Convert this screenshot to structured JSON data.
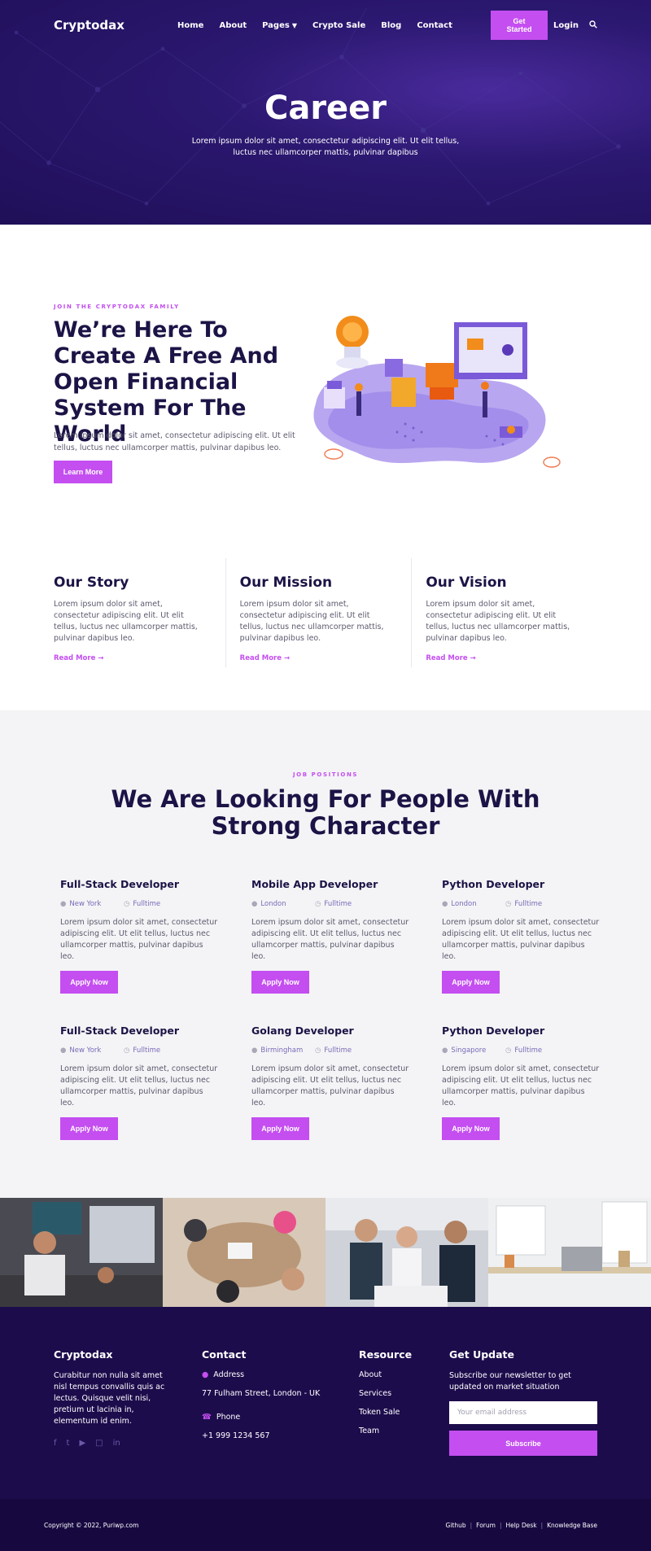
{
  "nav": {
    "logo": "Cryptodax",
    "items": [
      "Home",
      "About",
      "Pages",
      "Crypto Sale",
      "Blog",
      "Contact"
    ],
    "get_started": "Get Started",
    "login": "Login"
  },
  "hero": {
    "title": "Career",
    "subtitle": "Lorem ipsum dolor sit amet, consectetur adipiscing elit. Ut elit tellus, luctus nec ullamcorper mattis, pulvinar dapibus"
  },
  "intro": {
    "eyebrow": "JOIN THE CRYPTODAX FAMILY",
    "heading": "We’re Here To Create A Free And Open Financial System For The World",
    "text": "Lorem ipsum dolor sit amet, consectetur adipiscing elit. Ut elit tellus, luctus nec ullamcorper mattis, pulvinar dapibus leo.",
    "button": "Learn More"
  },
  "story": [
    {
      "title": "Our Story",
      "text": "Lorem ipsum dolor sit amet, consectetur adipiscing elit. Ut elit tellus, luctus nec ullamcorper mattis, pulvinar dapibus leo.",
      "link": "Read More"
    },
    {
      "title": "Our Mission",
      "text": "Lorem ipsum dolor sit amet, consectetur adipiscing elit. Ut elit tellus, luctus nec ullamcorper mattis, pulvinar dapibus leo.",
      "link": "Read More"
    },
    {
      "title": "Our Vision",
      "text": "Lorem ipsum dolor sit amet, consectetur adipiscing elit. Ut elit tellus, luctus nec ullamcorper mattis, pulvinar dapibus leo.",
      "link": "Read More"
    }
  ],
  "jobs": {
    "eyebrow": "JOB POSITIONS",
    "heading": "We Are Looking For People With Strong Character",
    "items": [
      {
        "title": "Full-Stack Developer",
        "location": "New York",
        "type": "Fulltime",
        "text": "Lorem ipsum dolor sit amet, consectetur adipiscing elit. Ut elit tellus, luctus nec ullamcorper mattis, pulvinar dapibus leo.",
        "button": "Apply Now"
      },
      {
        "title": "Mobile App Developer",
        "location": "London",
        "type": "Fulltime",
        "text": "Lorem ipsum dolor sit amet, consectetur adipiscing elit. Ut elit tellus, luctus nec ullamcorper mattis, pulvinar dapibus leo.",
        "button": "Apply Now"
      },
      {
        "title": "Python Developer",
        "location": "London",
        "type": "Fulltime",
        "text": "Lorem ipsum dolor sit amet, consectetur adipiscing elit. Ut elit tellus, luctus nec ullamcorper mattis, pulvinar dapibus leo.",
        "button": "Apply Now"
      },
      {
        "title": "Full-Stack Developer",
        "location": "New York",
        "type": "Fulltime",
        "text": "Lorem ipsum dolor sit amet, consectetur adipiscing elit. Ut elit tellus, luctus nec ullamcorper mattis, pulvinar dapibus leo.",
        "button": "Apply Now"
      },
      {
        "title": "Golang Developer",
        "location": "Birmingham",
        "type": "Fulltime",
        "text": "Lorem ipsum dolor sit amet, consectetur adipiscing elit. Ut elit tellus, luctus nec ullamcorper mattis, pulvinar dapibus leo.",
        "button": "Apply Now"
      },
      {
        "title": "Python Developer",
        "location": "Singapore",
        "type": "Fulltime",
        "text": "Lorem ipsum dolor sit amet, consectetur adipiscing elit. Ut elit tellus, luctus nec ullamcorper mattis, pulvinar dapibus leo.",
        "button": "Apply Now"
      }
    ]
  },
  "footer": {
    "brand": "Cryptodax",
    "about": "Curabitur non nulla sit amet nisl tempus convallis quis ac lectus. Quisque velit nisi, pretium ut lacinia in, elementum id enim.",
    "contact_title": "Contact",
    "address_label": "Address",
    "address": "77 Fulham Street, London - UK",
    "phone_label": "Phone",
    "phone": "+1 999 1234 567",
    "resource_title": "Resource",
    "resources": [
      "About",
      "Services",
      "Token Sale",
      "Team"
    ],
    "update_title": "Get Update",
    "update_text": "Subscribe our newsletter to get updated on market situation",
    "email_placeholder": "Your email address",
    "subscribe": "Subscribe",
    "copyright": "Copyright © 2022, Puriwp.com",
    "bottom_links": [
      "Github",
      "Forum",
      "Help Desk",
      "Knowledge Base"
    ]
  },
  "colors": {
    "accent": "#c44ef0",
    "dark": "#1c1346",
    "footer": "#1d0c4c",
    "hero": "#2b1870"
  },
  "icons": [
    "search-icon",
    "chevron-down-icon",
    "arrow-right-icon",
    "map-pin-icon",
    "clock-icon",
    "phone-icon",
    "facebook-icon",
    "twitter-icon",
    "youtube-icon",
    "instagram-icon",
    "linkedin-icon"
  ]
}
